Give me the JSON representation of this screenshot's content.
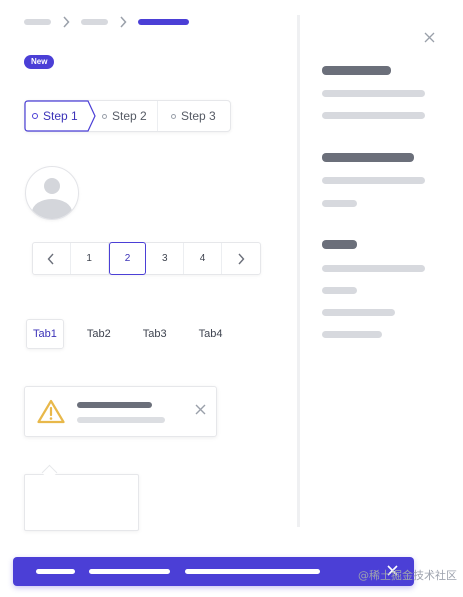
{
  "badge": {
    "label": "New"
  },
  "steps": [
    {
      "label": "Step 1",
      "active": true
    },
    {
      "label": "Step 2",
      "active": false
    },
    {
      "label": "Step 3",
      "active": false
    }
  ],
  "pagination": {
    "pages": [
      "1",
      "2",
      "3",
      "4"
    ],
    "current": "2"
  },
  "tabs": [
    {
      "label": "Tab1",
      "active": true
    },
    {
      "label": "Tab2",
      "active": false
    },
    {
      "label": "Tab3",
      "active": false
    },
    {
      "label": "Tab4",
      "active": false
    }
  ],
  "watermark": {
    "text": "@稀土掘金技术社区"
  },
  "colors": {
    "accent": "#4b3fd6",
    "warning": "#e8b84a",
    "placeholder_dark": "#6b6f7a",
    "placeholder_light": "#d7d9de"
  },
  "icons": {
    "breadcrumb_sep": "chevron-right-icon",
    "prev": "chevron-left-icon",
    "next": "chevron-right-icon",
    "alert": "warning-icon",
    "close": "close-icon",
    "avatar": "user-icon"
  }
}
